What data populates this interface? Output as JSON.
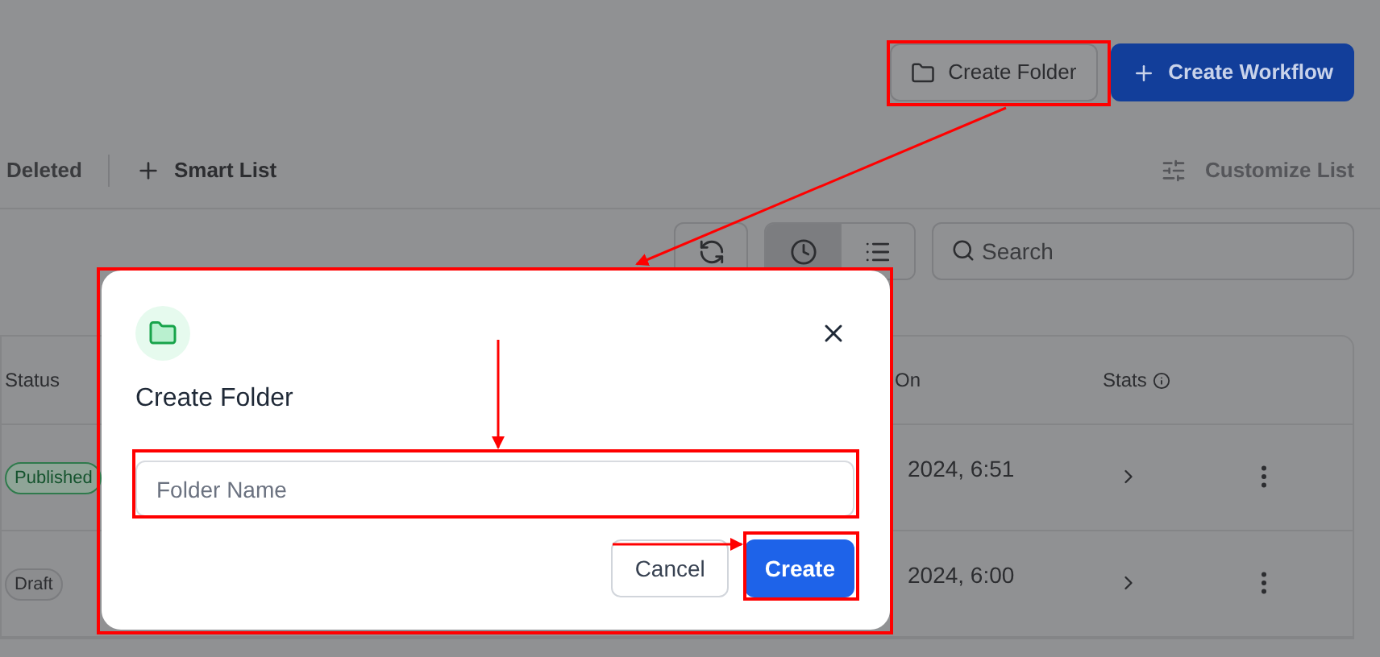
{
  "header_buttons": [
    {
      "label": "Create Folder",
      "kind": "outline"
    },
    {
      "label": "Create Workflow",
      "kind": "primary"
    }
  ],
  "list_bar": {
    "deleted": "Deleted",
    "smart_list": "Smart List",
    "customize": "Customize List"
  },
  "view_toggles": [
    {
      "kind": "clock",
      "selected": true
    },
    {
      "kind": "list",
      "selected": false
    }
  ],
  "search": {
    "placeholder": "Search"
  },
  "table": {
    "columns": [
      "Status",
      "On",
      "Stats"
    ],
    "rows": [
      {
        "status": "Published",
        "kind": "published",
        "date": "2024, 6:51"
      },
      {
        "status": "Draft",
        "kind": "draft",
        "date": "2024, 6:00"
      }
    ]
  },
  "dialog": {
    "title": "Create Folder",
    "placeholder": "Folder Name",
    "cancel": "Cancel",
    "create": "Create"
  }
}
